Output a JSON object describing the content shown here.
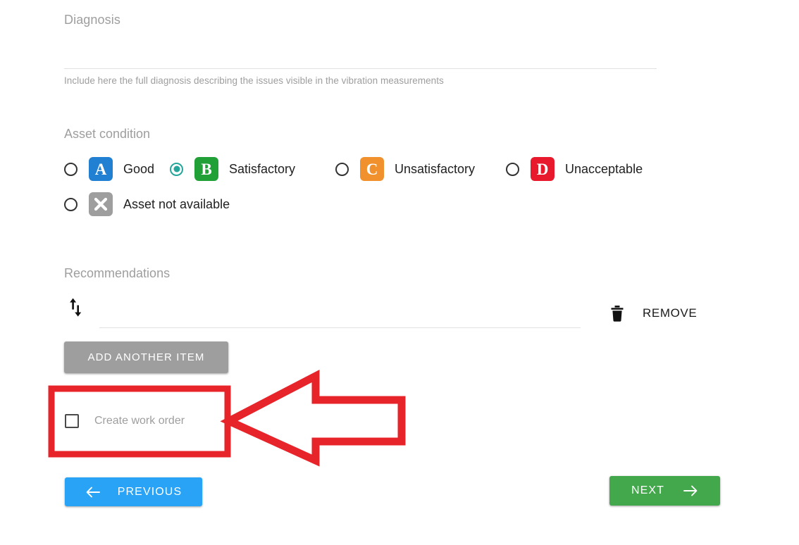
{
  "diagnosis": {
    "label": "Diagnosis",
    "value": "",
    "placeholder": "",
    "helper_text": "Include here the full diagnosis describing the issues visible in the vibration measurements"
  },
  "asset_condition": {
    "label": "Asset condition",
    "selected": "Satisfactory",
    "options": [
      {
        "grade": "A",
        "label": "Good",
        "color": "#2280d3",
        "selected": false
      },
      {
        "grade": "B",
        "label": "Satisfactory",
        "color": "#21a038",
        "selected": true
      },
      {
        "grade": "C",
        "label": "Unsatisfactory",
        "color": "#f0912d",
        "selected": false
      },
      {
        "grade": "D",
        "label": "Unacceptable",
        "color": "#e8192c",
        "selected": false
      },
      {
        "grade": "X",
        "label": "Asset not available",
        "color": "#9e9e9e",
        "selected": false
      }
    ],
    "radio_selected_color": "#26a69a"
  },
  "recommendations": {
    "label": "Recommendations",
    "items": [
      {
        "value": "",
        "placeholder": "",
        "reorder_icon": "sort-up-down-icon",
        "remove_label": "REMOVE",
        "remove_icon": "trash-icon"
      }
    ],
    "add_button_label": "ADD ANOTHER ITEM"
  },
  "work_order": {
    "label": "Create work order",
    "checked": false
  },
  "navigation": {
    "previous_label": "PREVIOUS",
    "previous_icon": "arrow-left-icon",
    "previous_color": "#29a3f5",
    "next_label": "NEXT",
    "next_icon": "arrow-right-icon",
    "next_color": "#42a84b"
  },
  "annotation": {
    "highlight_color": "#e8242b",
    "shapes": [
      "highlight-rectangle",
      "pointer-arrow-left"
    ]
  }
}
